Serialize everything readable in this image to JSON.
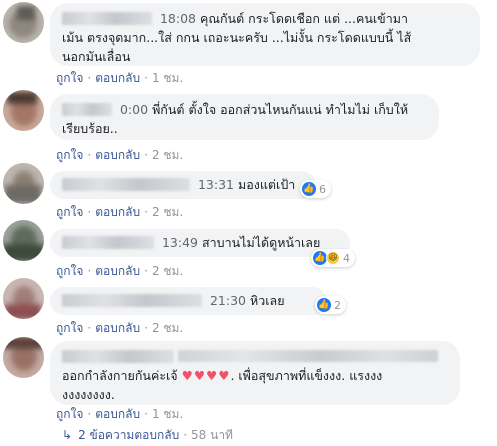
{
  "comments": [
    {
      "timestamp": "18:08",
      "text_line1": "คุณกันต์ กระโดดเชือก แต่ ...คนเข้ามา",
      "text_line2": "เม้น ตรงจุดมาก...ใส่ กกน เถอะนะครับ ...ไม่งั้น กระโดดแบบนี้ ไส้",
      "text_line3": "นอกมันเลื่อน",
      "like": "ถูกใจ",
      "reply": "ตอบกลับ",
      "time": "1 ชม."
    },
    {
      "timestamp": "0:00",
      "text_line1": "พี่กันต์ ตั้งใจ ออกส่วนไหนกันแน่ ทำไมไม่ เก็บให้",
      "text_line2": "เรียบร้อย..",
      "like": "ถูกใจ",
      "reply": "ตอบกลับ",
      "time": "2 ชม."
    },
    {
      "timestamp": "13:31",
      "text_line1": "มองแต่เป้า",
      "reaction_count": "6",
      "like": "ถูกใจ",
      "reply": "ตอบกลับ",
      "time": "2 ชม."
    },
    {
      "timestamp": "13:49",
      "text_line1": "สาบานไม่ได้ดูหน้าเลย",
      "reaction_count": "4",
      "like": "ถูกใจ",
      "reply": "ตอบกลับ",
      "time": "2 ชม."
    },
    {
      "timestamp": "21:30",
      "text_line1": "หิวเลย",
      "reaction_count": "2",
      "like": "ถูกใจ",
      "reply": "ตอบกลับ",
      "time": "2 ชม."
    },
    {
      "text_line2_start": "ออกกำลังกายกันค่ะเจ้",
      "hearts": "♥♥♥♥",
      "text_line2_end": ". เพื่อสุขภาพที่แข็งงง. แรงงง",
      "text_line3": "งงงงงงงง.",
      "like": "ถูกใจ",
      "reply": "ตอบกลับ",
      "time": "1 ชม."
    }
  ],
  "replies_link": {
    "label": "2 ข้อความตอบกลับ",
    "time": "58 นาที"
  },
  "colors": {
    "bubble": "#f2f3f5",
    "link": "#385898",
    "meta": "#90949c",
    "like_blue": "#2078f4",
    "heart": "#f25268"
  }
}
